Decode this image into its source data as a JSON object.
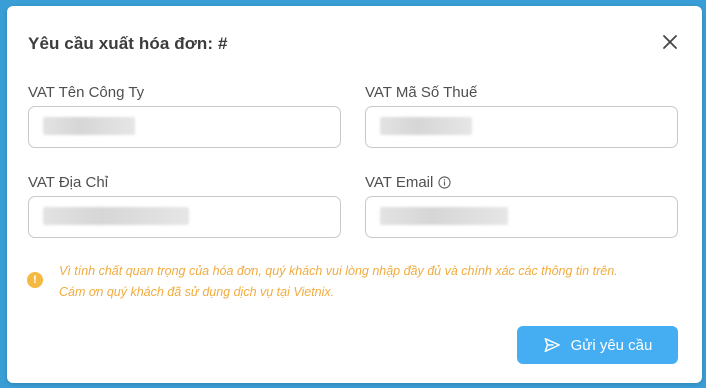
{
  "modal": {
    "title": "Yêu cầu xuất hóa đơn: #",
    "close_icon": "close-icon"
  },
  "fields": {
    "company_name": {
      "label": "VAT Tên Công Ty",
      "value": ""
    },
    "tax_code": {
      "label": "VAT Mã Số Thuế",
      "value": ""
    },
    "address": {
      "label": "VAT Địa Chỉ",
      "value": ""
    },
    "email": {
      "label": "VAT Email",
      "value": "",
      "icon": "info-icon"
    }
  },
  "notice": {
    "icon": "warning-icon",
    "line1": "Vì tính chất quan trọng của hóa đơn, quý khách vui lòng nhập đầy đủ và chính xác các thông tin trên.",
    "line2": "Cám ơn quý khách đã sử dụng dịch vụ tại Vietnix.",
    "color": "#f0ac3f"
  },
  "actions": {
    "submit_label": "Gửi yêu cầu",
    "submit_icon": "send-icon",
    "submit_color": "#45aef2"
  }
}
